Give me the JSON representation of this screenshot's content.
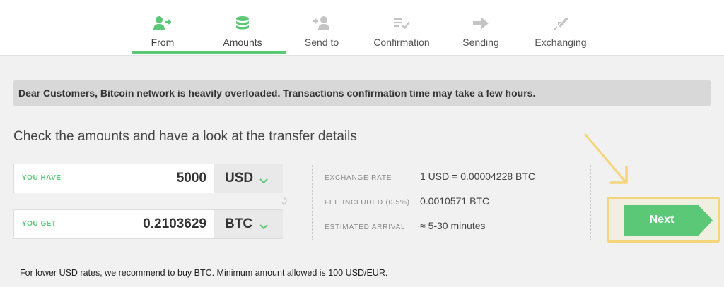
{
  "steps": [
    {
      "label": "From",
      "icon": "user-arrow-icon",
      "active": true
    },
    {
      "label": "Amounts",
      "icon": "coins-stack-icon",
      "active": true
    },
    {
      "label": "Send to",
      "icon": "user-add-icon",
      "active": false
    },
    {
      "label": "Confirmation",
      "icon": "checklist-icon",
      "active": false
    },
    {
      "label": "Sending",
      "icon": "arrow-right-icon",
      "active": false
    },
    {
      "label": "Exchanging",
      "icon": "rocket-icon",
      "active": false
    }
  ],
  "notice": "Dear Customers, Bitcoin network is heavily overloaded. Transactions confirmation time may take a few hours.",
  "headline": "Check the amounts and have a look at the transfer details",
  "have": {
    "label": "YOU HAVE",
    "value": "5000",
    "currency": "USD"
  },
  "get": {
    "label": "YOU GET",
    "value": "0.2103629",
    "currency": "BTC"
  },
  "details": {
    "rate_label": "EXCHANGE RATE",
    "rate_value": "1 USD = 0.00004228 BTC",
    "fee_label": "FEE INCLUDED (0.5%)",
    "fee_value": "0.0010571 BTC",
    "arrival_label": "ESTIMATED ARRIVAL",
    "arrival_value": "≈ 5-30 minutes"
  },
  "next_label": "Next",
  "footnote": "For lower USD rates, we recommend to buy BTC. Minimum amount allowed is 100 USD/EUR.",
  "colors": {
    "accent": "#5bc878",
    "inactive": "#c4c4c4",
    "highlight": "#f5d57a"
  }
}
